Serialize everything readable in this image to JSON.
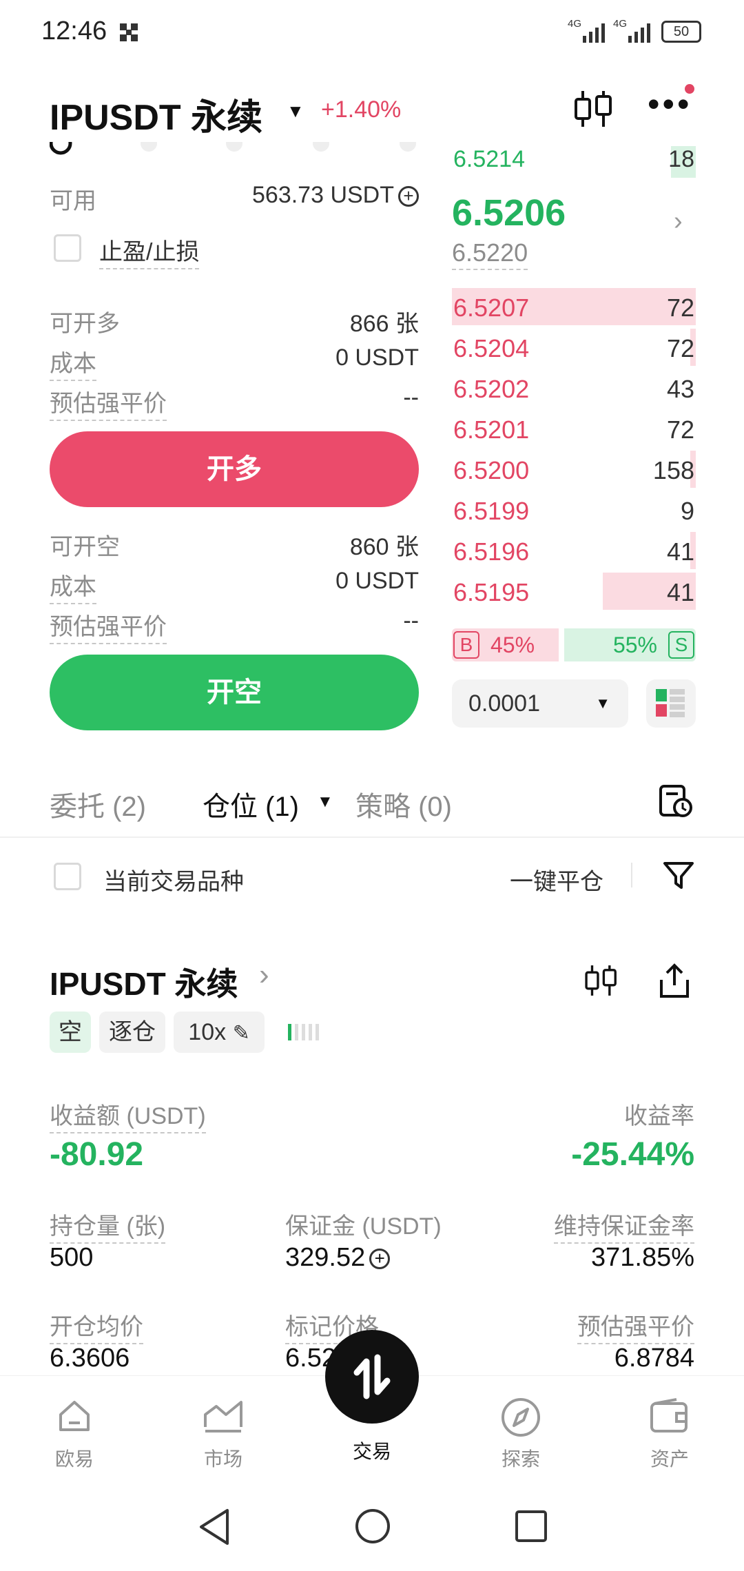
{
  "status_bar": {
    "time": "12:46",
    "signal_1": "4G",
    "signal_2": "4G",
    "battery": "50"
  },
  "header": {
    "pair": "IPUSDT 永续",
    "change": "+1.40%"
  },
  "order_panel": {
    "available_label": "可用",
    "available_value": "563.73 USDT",
    "tp_sl_label": "止盈/止损",
    "long": {
      "max_label": "可开多",
      "max_value": "866 张",
      "cost_label": "成本",
      "cost_value": "0 USDT",
      "liq_label": "预估强平价",
      "liq_value": "--",
      "button": "开多"
    },
    "short": {
      "max_label": "可开空",
      "max_value": "860 张",
      "cost_label": "成本",
      "cost_value": "0 USDT",
      "liq_label": "预估强平价",
      "liq_value": "--",
      "button": "开空"
    }
  },
  "orderbook": {
    "top_bid": {
      "price": "6.5214",
      "qty": "18"
    },
    "last_price": "6.5206",
    "mark_price": "6.5220",
    "asks": [
      {
        "price": "6.5207",
        "qty": "72",
        "depth": 1.0
      },
      {
        "price": "6.5204",
        "qty": "72",
        "depth": 0.03
      },
      {
        "price": "6.5202",
        "qty": "43",
        "depth": 0.0
      },
      {
        "price": "6.5201",
        "qty": "72",
        "depth": 0.0
      },
      {
        "price": "6.5200",
        "qty": "158",
        "depth": 0.03
      },
      {
        "price": "6.5199",
        "qty": "9",
        "depth": 0.0
      },
      {
        "price": "6.5196",
        "qty": "41",
        "depth": 0.03
      },
      {
        "price": "6.5195",
        "qty": "41",
        "depth": 0.38
      }
    ],
    "buy_tag": "B",
    "buy_pct": "45%",
    "buy_ratio": 0.45,
    "sell_pct": "55%",
    "sell_tag": "S",
    "precision": "0.0001"
  },
  "tabs": {
    "orders": "委托 (2)",
    "positions": "仓位 (1)",
    "strategy": "策略 (0)"
  },
  "filter_bar": {
    "current_only": "当前交易品种",
    "close_all": "一键平仓"
  },
  "position": {
    "pair": "IPUSDT 永续",
    "side_tag": "空",
    "margin_mode": "逐仓",
    "leverage": "10x",
    "pnl_label": "收益额 (USDT)",
    "pnl_value": "-80.92",
    "roe_label": "收益率",
    "roe_value": "-25.44%",
    "size_label": "持仓量 (张)",
    "size_value": "500",
    "margin_label": "保证金 (USDT)",
    "margin_value": "329.52",
    "mmr_label": "维持保证金率",
    "mmr_value": "371.85%",
    "entry_label": "开仓均价",
    "entry_value": "6.3606",
    "mark_label": "标记价格",
    "mark_value": "6.52",
    "liq_label": "预估强平价",
    "liq_value": "6.8784"
  },
  "bottom_nav": {
    "home": "欧易",
    "market": "市场",
    "trade": "交易",
    "explore": "探索",
    "assets": "资产"
  },
  "colors": {
    "red": "#e24563",
    "green": "#24b35f",
    "long_button": "#eb4b6b",
    "short_button": "#2dbf63"
  }
}
